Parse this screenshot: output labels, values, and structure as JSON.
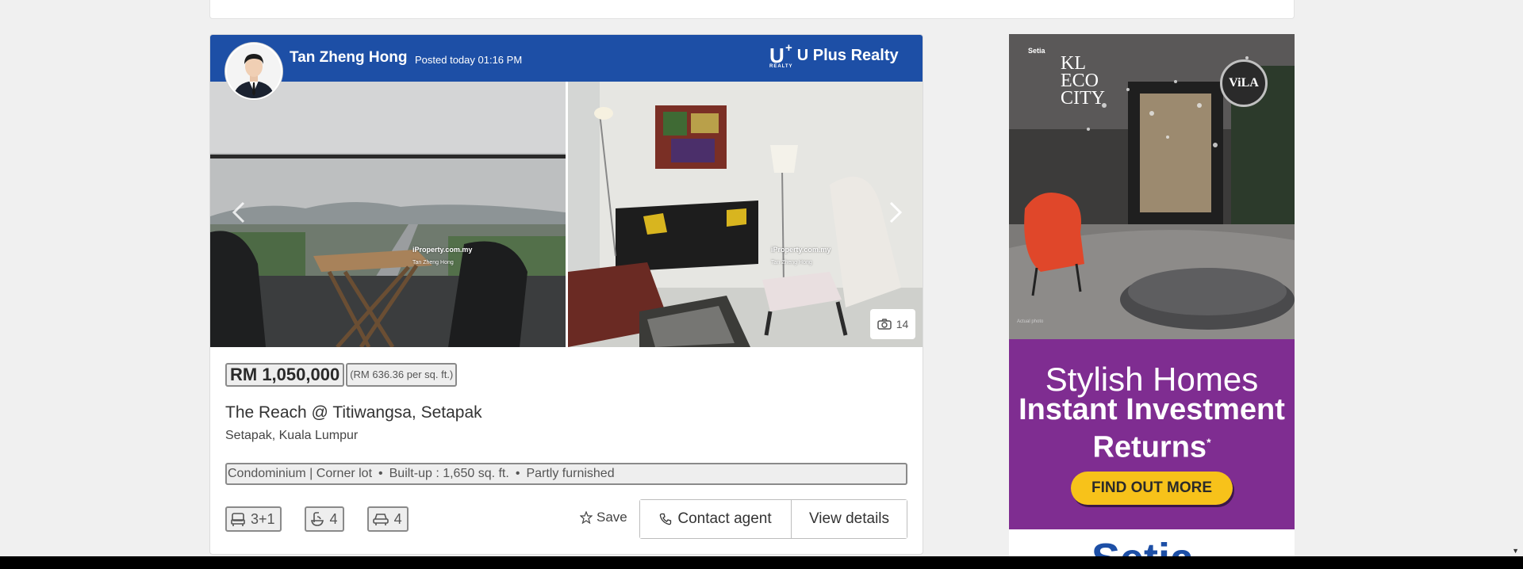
{
  "agent": {
    "name": "Tan Zheng Hong",
    "posted": "Posted today 01:16 PM"
  },
  "agency": {
    "logo_mark": "U",
    "logo_plus": "+",
    "logo_small": "REALTY",
    "name": "U Plus Realty"
  },
  "gallery": {
    "photo_count": "14",
    "watermark_site": "iProperty.com.my",
    "watermark_agent": "Tan Zheng Hong"
  },
  "listing": {
    "price": "RM 1,050,000",
    "price_per_sqft": "(RM 636.36 per sq. ft.)",
    "title": "The Reach @ Titiwangsa, Setapak",
    "location": "Setapak, Kuala Lumpur",
    "attributes": {
      "type": "Condominium | Corner lot",
      "built_up": "Built-up : 1,650 sq. ft.",
      "furnishing": "Partly furnished",
      "separator": "•"
    },
    "features": {
      "bedrooms": "3+1",
      "bathrooms": "4",
      "parking": "4"
    }
  },
  "actions": {
    "save": "Save",
    "contact": "Contact agent",
    "view": "View details"
  },
  "ad": {
    "brand_small": "Setia",
    "brand_lines": [
      "KL",
      "ECO",
      "CITY"
    ],
    "badge": "ViLA",
    "disclaimer": "Actual photo",
    "headline1": "Stylish Homes",
    "headline2_line1": "Instant Investment",
    "headline2_line2": "Returns",
    "headline2_mark": "*",
    "cta": "FIND OUT MORE",
    "bottom_logo": "Setia"
  },
  "colors": {
    "header_blue": "#1d4fa6",
    "ad_purple": "#7f2d91",
    "ad_cta_yellow": "#f7c21a"
  },
  "icons": [
    "chevron-left-icon",
    "chevron-right-icon",
    "camera-icon",
    "star-icon",
    "phone-icon",
    "bed-icon",
    "bath-icon",
    "car-icon"
  ]
}
